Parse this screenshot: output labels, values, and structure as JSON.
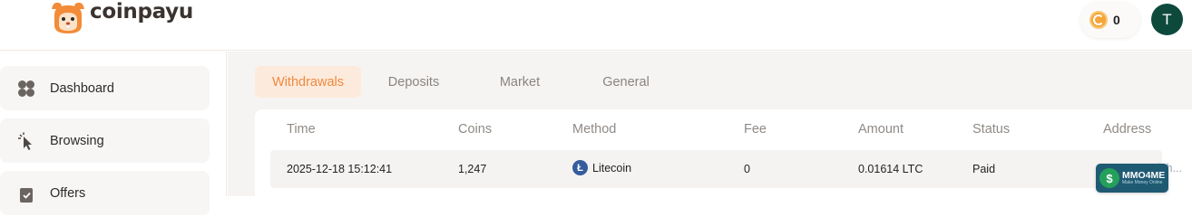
{
  "header": {
    "logo_text": "coinpayu",
    "coin_balance": "0",
    "avatar_initial": "T"
  },
  "sidebar": {
    "items": [
      {
        "label": "Dashboard",
        "icon": "dashboard-icon"
      },
      {
        "label": "Browsing",
        "icon": "cursor-icon"
      },
      {
        "label": "Offers",
        "icon": "offers-icon"
      }
    ]
  },
  "tabs": [
    {
      "label": "Withdrawals",
      "active": true
    },
    {
      "label": "Deposits",
      "active": false
    },
    {
      "label": "Market",
      "active": false
    },
    {
      "label": "General",
      "active": false
    }
  ],
  "table": {
    "columns": [
      "Time",
      "Coins",
      "Method",
      "Fee",
      "Amount",
      "Status",
      "Address"
    ],
    "rows": [
      {
        "time": "2025-12-18 15:12:41",
        "coins": "1,247",
        "method": "Litecoin",
        "fee": "0",
        "amount": "0.01614 LTC",
        "status": "Paid",
        "address": "LXdah..."
      }
    ]
  },
  "watermark": {
    "text": "MMO4ME",
    "subtext": "Make Money Online",
    "symbol": "$"
  },
  "colors": {
    "accent": "#f0883e",
    "accent_bg": "#fcebdc",
    "avatar_bg": "#0d4a3c",
    "litecoin": "#345d9d"
  }
}
